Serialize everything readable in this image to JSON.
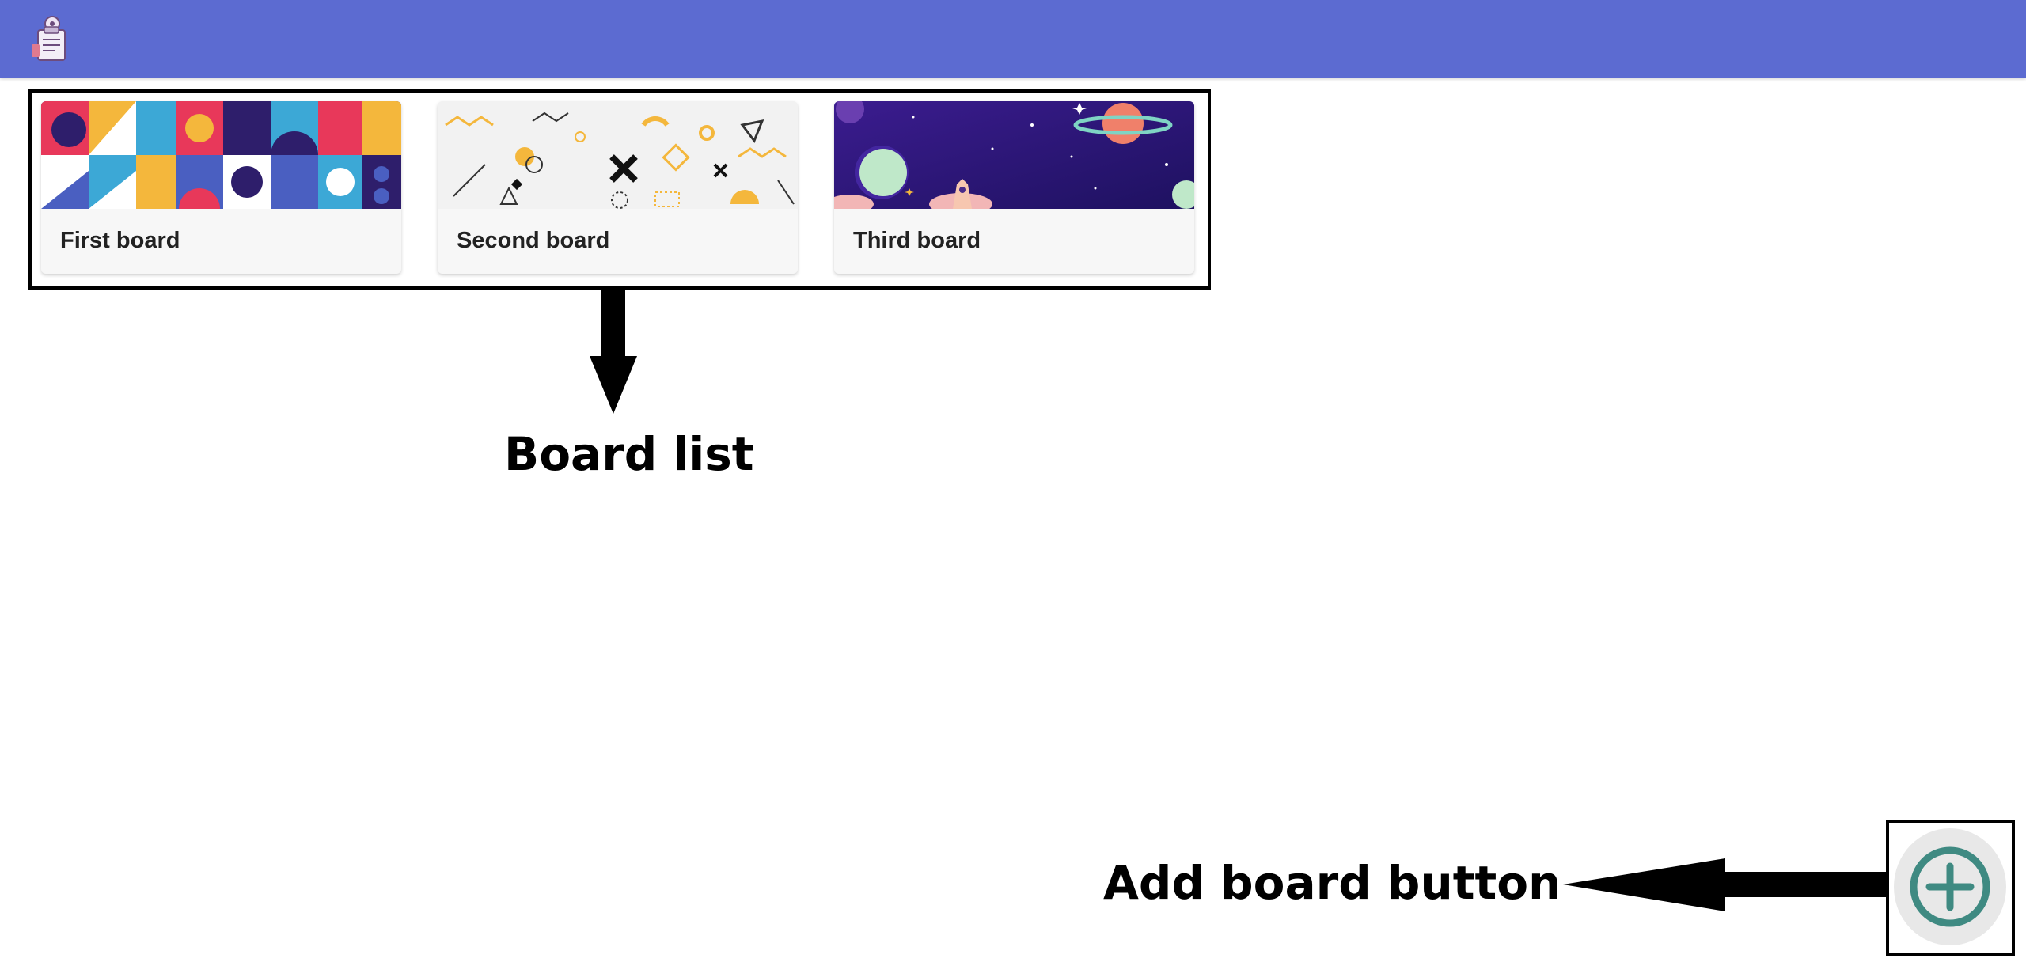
{
  "boards": [
    {
      "title": "First board",
      "cover": "geometric-pattern"
    },
    {
      "title": "Second board",
      "cover": "memphis-shapes"
    },
    {
      "title": "Third board",
      "cover": "space-planets"
    }
  ],
  "annotations": {
    "board_list": "Board list",
    "add_board_button": "Add board button"
  },
  "header": {
    "logo_icon": "clipboard-mascot-icon",
    "background": "#5c6bd1"
  },
  "add_button": {
    "icon": "plus-circle-icon",
    "color": "#3f8a82"
  }
}
